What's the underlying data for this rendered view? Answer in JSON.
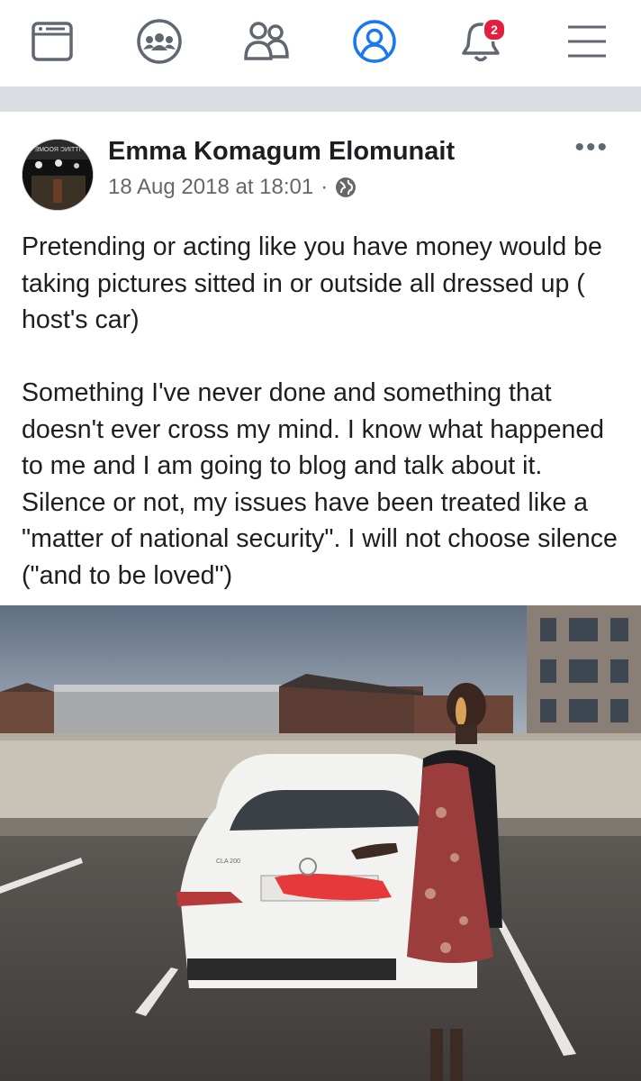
{
  "nav": {
    "items": [
      "news-feed",
      "groups",
      "friends",
      "profile",
      "notifications",
      "menu"
    ],
    "notification_count": "2",
    "active_color": "#1877f2",
    "icon_color": "#606770"
  },
  "post": {
    "author": "Emma Komagum Elomunait",
    "timestamp": "18 Aug 2018 at 18:01",
    "separator": "·",
    "privacy_icon": "globe-icon",
    "more_label": "•••",
    "text": "Pretending or acting like you have money would be taking pictures sitted in or outside all dressed up ( host's car)\n\nSomething I've never done and something that doesn't ever cross my mind. I know what happened to me and I am going to blog and talk about it. Silence or not, my issues have been treated like a \"matter of national security\". I will not choose silence (\"and to be loved\")",
    "avatar_sign_text": "ƎMOOЯ ƆИITTI",
    "car_badge": "CLA 200"
  }
}
